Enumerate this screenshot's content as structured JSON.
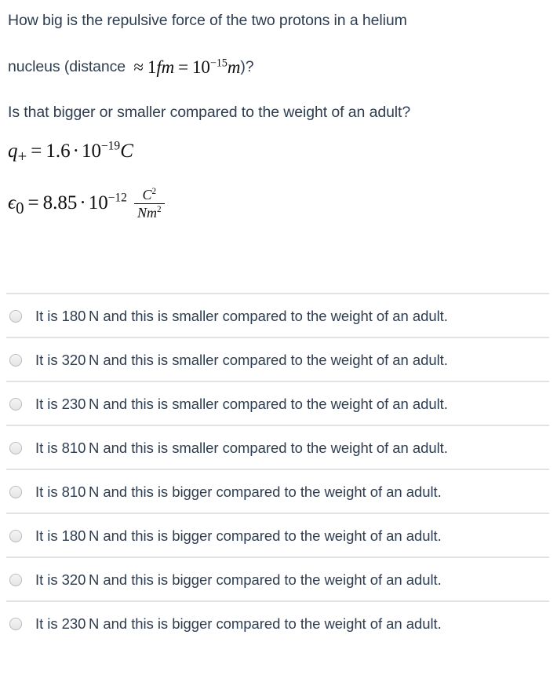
{
  "question": {
    "line1": "How big is the repulsive force of the two protons in a helium",
    "line2_prefix": "nucleus (distance ",
    "line2_math": {
      "approx": "≈",
      "value": "1",
      "unit": "fm",
      "equals": "=",
      "base": "10",
      "exponent": "−15",
      "unit2": "m"
    },
    "line2_suffix": ")?",
    "line3": "Is that bigger or smaller compared to the weight of an adult?"
  },
  "givens": [
    {
      "name": "charge-of-proton",
      "symbol": "q",
      "subscript": "+",
      "equals": "=",
      "mantissa": "1.6",
      "dot": "·",
      "base": "10",
      "exponent": "−19",
      "unit": "C"
    },
    {
      "name": "vacuum-permittivity",
      "symbol": "ϵ",
      "subscript": "0",
      "equals": "=",
      "mantissa": "8.85",
      "dot": "·",
      "base": "10",
      "exponent": "−12",
      "unit_numerator": "C",
      "unit_numerator_exp": "2",
      "unit_denominator": "Nm",
      "unit_denominator_exp": "2"
    }
  ],
  "options": [
    {
      "id": "option-1",
      "label": "It is 180 N and this is smaller compared to the weight of an adult.",
      "selected": false
    },
    {
      "id": "option-2",
      "label": "It is 320 N and this is smaller compared to the weight of an adult.",
      "selected": false
    },
    {
      "id": "option-3",
      "label": "It is 230 N and this is smaller compared to the weight of an adult.",
      "selected": false
    },
    {
      "id": "option-4",
      "label": "It is 810 N and this is smaller compared to the weight of an adult.",
      "selected": false
    },
    {
      "id": "option-5",
      "label": "It is 810 N and this is bigger compared to the weight of an adult.",
      "selected": false
    },
    {
      "id": "option-6",
      "label": "It is 180 N and this is bigger compared to the weight of an adult.",
      "selected": false
    },
    {
      "id": "option-7",
      "label": "It is 320 N and this is bigger compared to the weight of an adult.",
      "selected": false
    },
    {
      "id": "option-8",
      "label": "It is 230 N and this is bigger compared to the weight of an adult.",
      "selected": false
    }
  ],
  "colors": {
    "background": "#ffffff",
    "text": "#2e3d50",
    "math": "#101010",
    "divider": "#e2e2e2",
    "radio_border": "#b9b9b9",
    "radio_fill": "#ececec"
  }
}
